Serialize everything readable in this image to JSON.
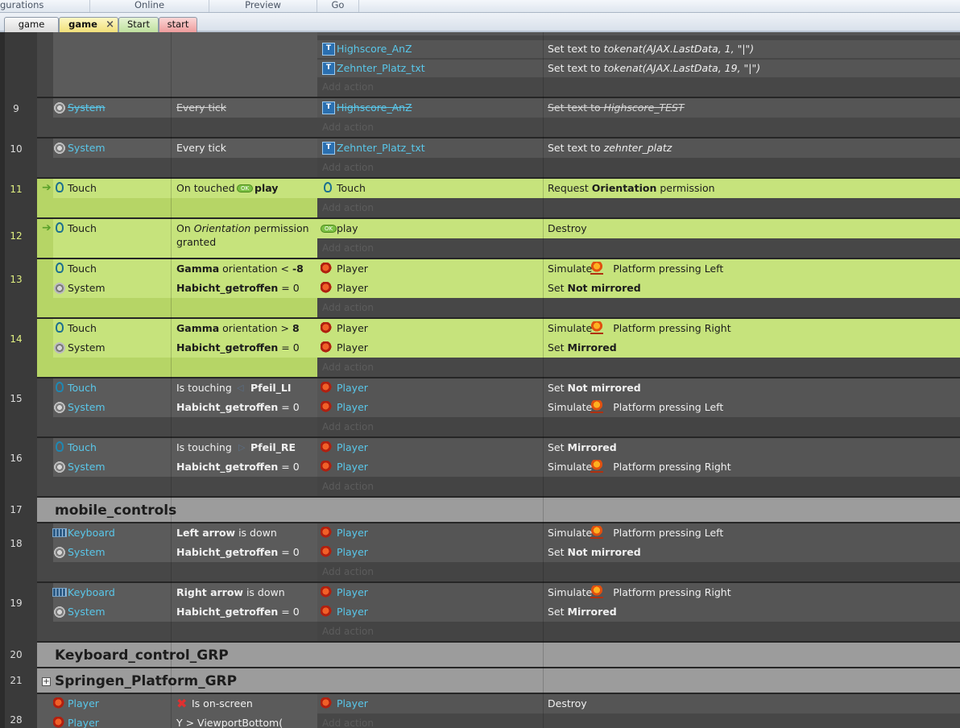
{
  "ribbon": {
    "items": [
      "gurations",
      "Online",
      "Preview",
      "Go"
    ]
  },
  "tabs": [
    {
      "label": "game"
    },
    {
      "label": "game",
      "close": "×"
    },
    {
      "label": "Start"
    },
    {
      "label": "start"
    }
  ],
  "rows": {
    "top": {
      "a0_obj": "Highscore_AnZ",
      "a0_text": "Set text to ",
      "a0_arg": "tokenat(AJAX.LastData, 1, \"|\")",
      "a1_obj": "Zehnter_Platz_txt",
      "a1_text": "Set text to ",
      "a1_arg": "tokenat(AJAX.LastData, 19, \"|\")",
      "add": "Add action"
    },
    "r9": {
      "num": "9",
      "c_obj": "System",
      "c_text": "Every tick",
      "a_obj": "Highscore_AnZ",
      "a_text": "Set text to ",
      "a_arg": "Highscore_TEST",
      "add": "Add action"
    },
    "r10": {
      "num": "10",
      "c_obj": "System",
      "c_text": "Every tick",
      "a_obj": "Zehnter_Platz_txt",
      "a_text": "Set text to ",
      "a_arg": "zehnter_platz",
      "add": "Add action"
    },
    "r11": {
      "num": "11",
      "c_obj": "Touch",
      "c_text": "On touched",
      "c_target": "play",
      "a_obj": "Touch",
      "a_pre": "Request ",
      "a_bold": "Orientation",
      "a_post": " permission",
      "add": "Add action"
    },
    "r12": {
      "num": "12",
      "c_obj": "Touch",
      "c_line1_pre": "On ",
      "c_line1_it": "Orientation",
      "c_line1_post": " permission",
      "c_line2": "granted",
      "a_obj": "play",
      "a_text": "Destroy",
      "add": "Add action"
    },
    "r13": {
      "num": "13",
      "c0_obj": "Touch",
      "c0_bold": "Gamma",
      "c0_text": " orientation < ",
      "c0_val": "-8",
      "c1_obj": "System",
      "c1_bold": "Habicht_getroffen",
      "c1_text": " = 0",
      "a0_obj": "Player",
      "a0_pre": "Simulate ",
      "a0_post": " Platform pressing Left",
      "a1_obj": "Player",
      "a1_pre": "Set ",
      "a1_bold": "Not mirrored",
      "add": "Add action"
    },
    "r14": {
      "num": "14",
      "c0_obj": "Touch",
      "c0_bold": "Gamma",
      "c0_text": " orientation > ",
      "c0_val": "8",
      "c1_obj": "System",
      "c1_bold": "Habicht_getroffen",
      "c1_text": " = 0",
      "a0_obj": "Player",
      "a0_pre": "Simulate ",
      "a0_post": " Platform pressing Right",
      "a1_obj": "Player",
      "a1_pre": "Set ",
      "a1_bold": "Mirrored",
      "add": "Add action"
    },
    "r15": {
      "num": "15",
      "c0_obj": "Touch",
      "c0_text": "Is touching ",
      "c0_target": "Pfeil_LI",
      "c1_obj": "System",
      "c1_bold": "Habicht_getroffen",
      "c1_text": " = 0",
      "a0_obj": "Player",
      "a0_pre": "Set ",
      "a0_bold": "Not mirrored",
      "a1_obj": "Player",
      "a1_pre": "Simulate ",
      "a1_post": " Platform pressing Left",
      "add": "Add action"
    },
    "r16": {
      "num": "16",
      "c0_obj": "Touch",
      "c0_text": "Is touching ",
      "c0_target": "Pfeil_RE",
      "c1_obj": "System",
      "c1_bold": "Habicht_getroffen",
      "c1_text": " = 0",
      "a0_obj": "Player",
      "a0_pre": "Set ",
      "a0_bold": "Mirrored",
      "a1_obj": "Player",
      "a1_pre": "Simulate ",
      "a1_post": " Platform pressing Right",
      "add": "Add action"
    },
    "r17": {
      "num": "17",
      "title": "mobile_controls"
    },
    "r18": {
      "num": "18",
      "c0_obj": "Keyboard",
      "c0_bold": "Left arrow",
      "c0_text": " is down",
      "c1_obj": "System",
      "c1_bold": "Habicht_getroffen",
      "c1_text": " = 0",
      "a0_obj": "Player",
      "a0_pre": "Simulate ",
      "a0_post": " Platform pressing Left",
      "a1_obj": "Player",
      "a1_pre": "Set ",
      "a1_bold": "Not mirrored",
      "add": "Add action"
    },
    "r19": {
      "num": "19",
      "c0_obj": "Keyboard",
      "c0_bold": "Right arrow",
      "c0_text": " is down",
      "c1_obj": "System",
      "c1_bold": "Habicht_getroffen",
      "c1_text": " = 0",
      "a0_obj": "Player",
      "a0_pre": "Simulate ",
      "a0_post": " Platform pressing Right",
      "a1_obj": "Player",
      "a1_pre": "Set ",
      "a1_bold": "Mirrored",
      "add": "Add action"
    },
    "r20": {
      "num": "20",
      "title": "Keyboard_control_GRP"
    },
    "r21": {
      "num": "21",
      "title": "Springen_Platform_GRP",
      "expand": "+"
    },
    "r28": {
      "num": "28",
      "c0_obj": "Player",
      "c0_text": "Is on-screen",
      "c1_obj": "Player",
      "c1_text": "Y > ViewportBottom(",
      "a_obj": "Player",
      "a_text": "Destroy",
      "add": "Add action"
    }
  },
  "colors": {
    "dark_cell": "#5b5b5b",
    "dark_bg": "#474747",
    "green_cell": "#c6e37c",
    "green_strip": "#b6d566",
    "group_bar": "#9c9c9c",
    "link": "#59c7ea"
  }
}
